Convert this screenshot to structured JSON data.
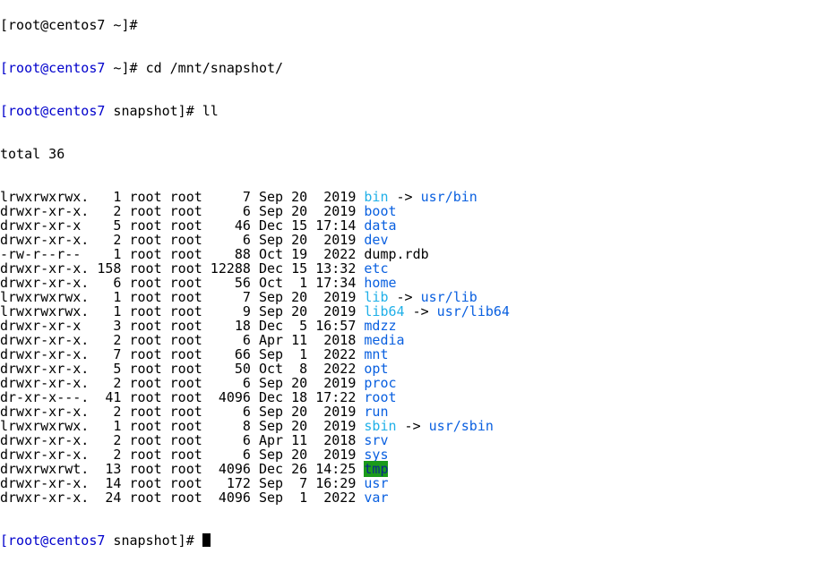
{
  "window": {
    "cut_off_line": "[root@centos7 ~]#"
  },
  "prompts": {
    "first_user": "[root@centos7",
    "first_rest": " ~]# ",
    "first_cmd": "cd /mnt/snapshot/",
    "second_user": "[root@centos7",
    "second_rest": " snapshot]# ",
    "second_cmd": "ll",
    "final_user": "[root@centos7",
    "final_rest": " snapshot]# "
  },
  "listing": {
    "total": "total 36",
    "entries": [
      {
        "meta": "lrwxrwxrwx.   1 root root     7 Sep 20  2019 ",
        "name": "bin",
        "kind": "link",
        "target": "usr/bin"
      },
      {
        "meta": "drwxr-xr-x.   2 root root     6 Sep 20  2019 ",
        "name": "boot",
        "kind": "dir"
      },
      {
        "meta": "drwxr-xr-x    5 root root    46 Dec 15 17:14 ",
        "name": "data",
        "kind": "dir"
      },
      {
        "meta": "drwxr-xr-x.   2 root root     6 Sep 20  2019 ",
        "name": "dev",
        "kind": "dir"
      },
      {
        "meta": "-rw-r--r--    1 root root    88 Oct 19  2022 ",
        "name": "dump.rdb",
        "kind": "file"
      },
      {
        "meta": "drwxr-xr-x. 158 root root 12288 Dec 15 13:32 ",
        "name": "etc",
        "kind": "dir"
      },
      {
        "meta": "drwxr-xr-x.   6 root root    56 Oct  1 17:34 ",
        "name": "home",
        "kind": "dir"
      },
      {
        "meta": "lrwxrwxrwx.   1 root root     7 Sep 20  2019 ",
        "name": "lib",
        "kind": "link",
        "target": "usr/lib"
      },
      {
        "meta": "lrwxrwxrwx.   1 root root     9 Sep 20  2019 ",
        "name": "lib64",
        "kind": "link",
        "target": "usr/lib64"
      },
      {
        "meta": "drwxr-xr-x    3 root root    18 Dec  5 16:57 ",
        "name": "mdzz",
        "kind": "dir"
      },
      {
        "meta": "drwxr-xr-x.   2 root root     6 Apr 11  2018 ",
        "name": "media",
        "kind": "dir"
      },
      {
        "meta": "drwxr-xr-x.   7 root root    66 Sep  1  2022 ",
        "name": "mnt",
        "kind": "dir"
      },
      {
        "meta": "drwxr-xr-x.   5 root root    50 Oct  8  2022 ",
        "name": "opt",
        "kind": "dir"
      },
      {
        "meta": "drwxr-xr-x.   2 root root     6 Sep 20  2019 ",
        "name": "proc",
        "kind": "dir"
      },
      {
        "meta": "dr-xr-x---.  41 root root  4096 Dec 18 17:22 ",
        "name": "root",
        "kind": "dir"
      },
      {
        "meta": "drwxr-xr-x.   2 root root     6 Sep 20  2019 ",
        "name": "run",
        "kind": "dir"
      },
      {
        "meta": "lrwxrwxrwx.   1 root root     8 Sep 20  2019 ",
        "name": "sbin",
        "kind": "link",
        "target": "usr/sbin"
      },
      {
        "meta": "drwxr-xr-x.   2 root root     6 Apr 11  2018 ",
        "name": "srv",
        "kind": "dir"
      },
      {
        "meta": "drwxr-xr-x.   2 root root     6 Sep 20  2019 ",
        "name": "sys",
        "kind": "dir"
      },
      {
        "meta": "drwxrwxrwt.  13 root root  4096 Dec 26 14:25 ",
        "name": "tmp",
        "kind": "sticky"
      },
      {
        "meta": "drwxr-xr-x.  14 root root   172 Sep  7 16:29 ",
        "name": "usr",
        "kind": "dir"
      },
      {
        "meta": "drwxr-xr-x.  24 root root  4096 Sep  1  2022 ",
        "name": "var",
        "kind": "dir"
      }
    ]
  },
  "colors": {
    "background": "#ffffff",
    "text": "#000000",
    "prompt": "#0000cc",
    "directory": "#0a60e0",
    "symlink": "#20b0e8",
    "sticky_bg": "#1a9a1a"
  }
}
